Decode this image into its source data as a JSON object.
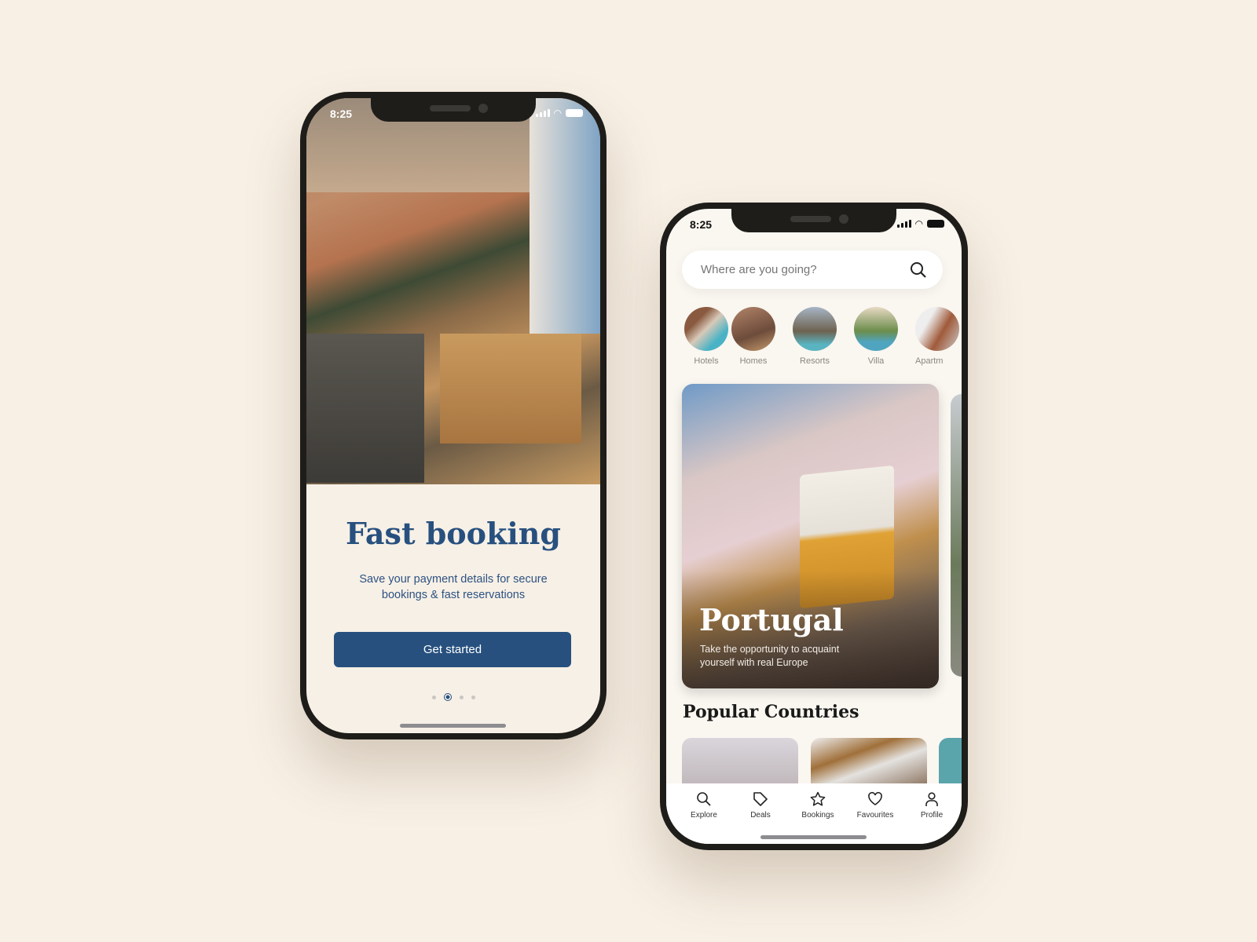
{
  "onboarding": {
    "status_time": "8:25",
    "title": "Fast booking",
    "subtitle_line1": "Save your payment details for secure",
    "subtitle_line2": "bookings & fast reservations",
    "cta_label": "Get started",
    "pager": {
      "total": 4,
      "active": 2
    },
    "colors": {
      "accent": "#27507f",
      "background": "#f7f0e6"
    }
  },
  "explore": {
    "status_time": "8:25",
    "search": {
      "placeholder": "Where are you going?",
      "icon": "search-icon"
    },
    "categories": [
      {
        "label": "Hotels"
      },
      {
        "label": "Homes"
      },
      {
        "label": "Resorts"
      },
      {
        "label": "Villa"
      },
      {
        "label": "Apartm"
      }
    ],
    "featured": {
      "title": "Portugal",
      "desc_line1": "Take the opportunity to acquaint",
      "desc_line2": "yourself with real Europe"
    },
    "section_title": "Popular Countries",
    "nav": [
      {
        "label": "Explore",
        "icon": "search-icon"
      },
      {
        "label": "Deals",
        "icon": "tag-icon"
      },
      {
        "label": "Bookings",
        "icon": "star-icon"
      },
      {
        "label": "Favourites",
        "icon": "heart-icon"
      },
      {
        "label": "Profile",
        "icon": "user-icon"
      }
    ]
  }
}
